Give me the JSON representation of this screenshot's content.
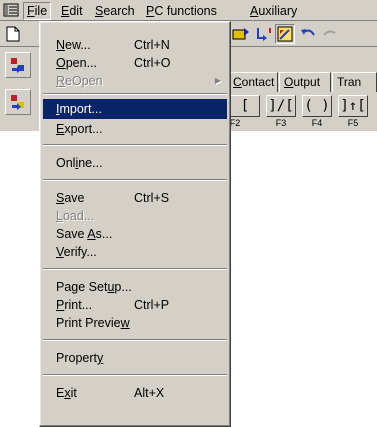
{
  "menubar": {
    "items": [
      {
        "pre": "",
        "acc": "F",
        "post": "ile"
      },
      {
        "pre": "",
        "acc": "E",
        "post": "dit"
      },
      {
        "pre": "",
        "acc": "S",
        "post": "earch"
      },
      {
        "pre": "",
        "acc": "P",
        "post": "C functions"
      },
      {
        "pre": "",
        "acc": "A",
        "post": "uxiliary"
      }
    ]
  },
  "tabs": {
    "contact": {
      "pre": "",
      "acc": "C",
      "post": "ontact"
    },
    "output": {
      "pre": "",
      "acc": "O",
      "post": "utput"
    },
    "tran": "Tran"
  },
  "ladder": {
    "buttons": [
      "[",
      "]/[",
      "( )",
      "]↑["
    ],
    "keys": [
      "F2",
      "F3",
      "F4",
      "F5"
    ]
  },
  "file_menu": {
    "new": {
      "pre": "",
      "acc": "N",
      "post": "ew...",
      "shortcut": "Ctrl+N"
    },
    "open": {
      "pre": "",
      "acc": "O",
      "post": "pen...",
      "shortcut": "Ctrl+O"
    },
    "reopen": {
      "pre": "",
      "acc": "R",
      "post": "eOpen"
    },
    "import": {
      "pre": "",
      "acc": "I",
      "post": "mport..."
    },
    "export": {
      "pre": "",
      "acc": "E",
      "post": "xport..."
    },
    "online": {
      "pre": "Onl",
      "acc": "i",
      "post": "ne..."
    },
    "save": {
      "pre": "",
      "acc": "S",
      "post": "ave",
      "shortcut": "Ctrl+S"
    },
    "load": {
      "pre": "",
      "acc": "L",
      "post": "oad..."
    },
    "save_as": {
      "pre": "Save ",
      "acc": "A",
      "post": "s..."
    },
    "verify": {
      "pre": "",
      "acc": "V",
      "post": "erify..."
    },
    "page_setup": {
      "pre": "Page Set",
      "acc": "u",
      "post": "p..."
    },
    "print": {
      "pre": "",
      "acc": "P",
      "post": "rint...",
      "shortcut": "Ctrl+P"
    },
    "print_preview": {
      "pre": "Print Previe",
      "acc": "w",
      "post": ""
    },
    "property": {
      "pre": "Propert",
      "acc": "y",
      "post": ""
    },
    "exit": {
      "pre": "E",
      "acc": "x",
      "post": "it",
      "shortcut": "Alt+X"
    }
  },
  "colors": {
    "highlight": "#0a246a",
    "face": "#d4d0c8"
  }
}
